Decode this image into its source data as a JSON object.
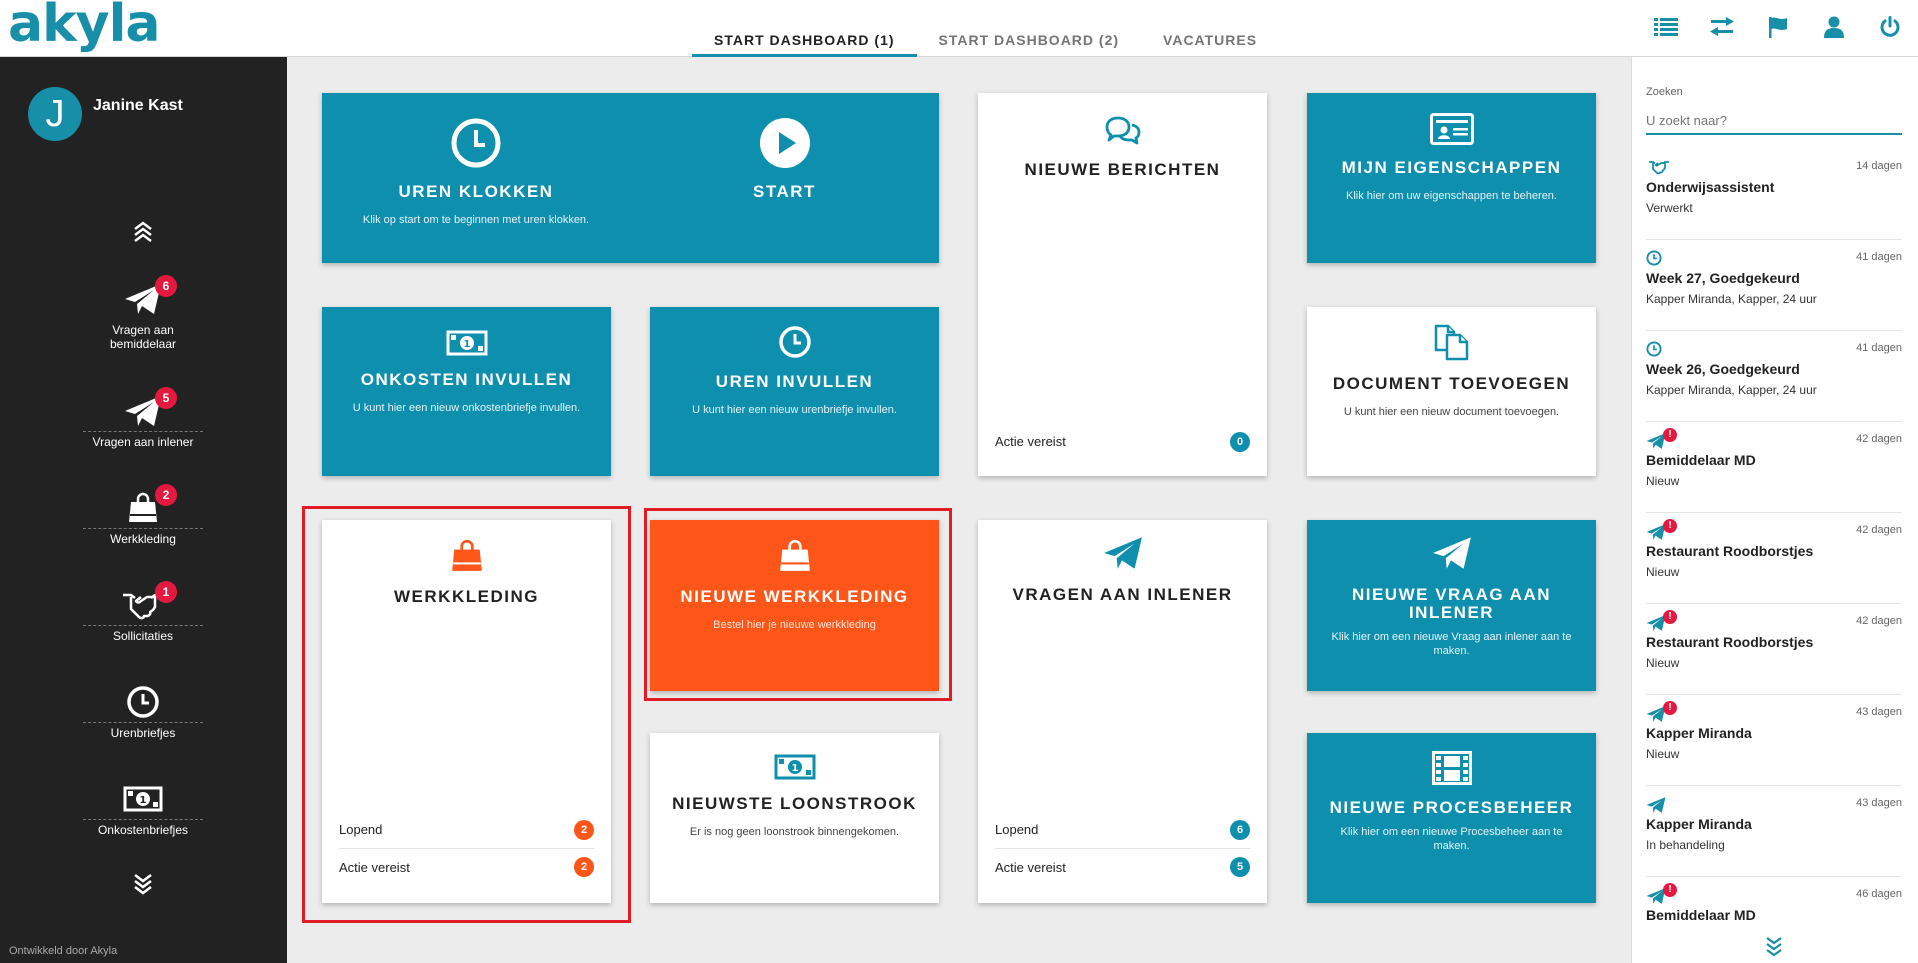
{
  "app": {
    "logo": "akyla",
    "accent": "#178fa8",
    "tile_teal": "#0d8fad",
    "tile_orange": "#fe5519",
    "badge_red": "#e4193f"
  },
  "tabs": [
    {
      "label": "START DASHBOARD (1)",
      "active": true
    },
    {
      "label": "START DASHBOARD (2)",
      "active": false
    },
    {
      "label": "VACATURES",
      "active": false
    }
  ],
  "top_icons": [
    "list-icon",
    "transfer-icon",
    "flag-icon",
    "user-icon",
    "power-icon"
  ],
  "user": {
    "initial": "J",
    "name": "Janine Kast"
  },
  "sidebar": {
    "items": [
      {
        "label": "Vragen aan bemiddelaar",
        "badge": "6",
        "icon": "paper-plane-icon"
      },
      {
        "label": "Vragen aan inlener",
        "badge": "5",
        "icon": "paper-plane-icon"
      },
      {
        "label": "Werkkleding",
        "badge": "2",
        "icon": "shopping-bag-icon"
      },
      {
        "label": "Sollicitaties",
        "badge": "1",
        "icon": "handshake-icon"
      },
      {
        "label": "Urenbriefjes",
        "badge": "",
        "icon": "clock-icon"
      },
      {
        "label": "Onkostenbriefjes",
        "badge": "",
        "icon": "money-icon"
      }
    ],
    "footer": "Ontwikkeld door Akyla"
  },
  "tiles": {
    "uren_klokken": {
      "title": "UREN KLOKKEN",
      "desc": "Klik op start om te beginnen met uren klokken."
    },
    "start": {
      "title": "START"
    },
    "nieuwe_berichten": {
      "title": "NIEUWE BERICHTEN",
      "footer": [
        {
          "label": "Actie vereist",
          "count": "0"
        }
      ]
    },
    "mijn_eigenschappen": {
      "title": "MIJN EIGENSCHAPPEN",
      "desc": "Klik hier om uw eigenschappen te beheren."
    },
    "onkosten_invullen": {
      "title": "ONKOSTEN INVULLEN",
      "desc": "U kunt hier een nieuw onkostenbriefje invullen."
    },
    "uren_invullen": {
      "title": "UREN INVULLEN",
      "desc": "U kunt hier een nieuw urenbriefje invullen."
    },
    "document_toevoegen": {
      "title": "DOCUMENT TOEVOEGEN",
      "desc": "U kunt hier een nieuw document toevoegen."
    },
    "werkkleding": {
      "title": "WERKKLEDING",
      "footer": [
        {
          "label": "Lopend",
          "count": "2"
        },
        {
          "label": "Actie vereist",
          "count": "2"
        }
      ]
    },
    "nieuwe_werkkleding": {
      "title": "NIEUWE WERKKLEDING",
      "desc": "Bestel hier je nieuwe werkkleding"
    },
    "vragen_aan_inlener": {
      "title": "VRAGEN AAN INLENER",
      "footer": [
        {
          "label": "Lopend",
          "count": "6"
        },
        {
          "label": "Actie vereist",
          "count": "5"
        }
      ]
    },
    "nieuwe_vraag_inlener": {
      "title": "NIEUWE VRAAG AAN INLENER",
      "desc": "Klik hier om een nieuwe Vraag aan inlener aan te maken."
    },
    "nieuwste_loonstrook": {
      "title": "NIEUWSTE LOONSTROOK",
      "desc": "Er is nog geen loonstrook binnengekomen."
    },
    "nieuwe_procesbeheer": {
      "title": "NIEUWE PROCESBEHEER",
      "desc": "Klik hier om een nieuwe Procesbeheer aan te maken."
    }
  },
  "search": {
    "label": "Zoeken",
    "placeholder": "U zoekt naar?"
  },
  "feed": [
    {
      "icon": "handshake-icon",
      "date": "14 dagen",
      "title": "Onderwijsassistent",
      "subtitle": "Verwerkt",
      "alert": false
    },
    {
      "icon": "clock-icon",
      "date": "41 dagen",
      "title": "Week 27, Goedgekeurd",
      "subtitle": "Kapper Miranda, Kapper, 24 uur",
      "alert": false
    },
    {
      "icon": "clock-icon",
      "date": "41 dagen",
      "title": "Week 26, Goedgekeurd",
      "subtitle": "Kapper Miranda, Kapper, 24 uur",
      "alert": false
    },
    {
      "icon": "paper-plane-icon",
      "date": "42 dagen",
      "title": "Bemiddelaar MD",
      "subtitle": "Nieuw",
      "alert": true
    },
    {
      "icon": "paper-plane-icon",
      "date": "42 dagen",
      "title": "Restaurant Roodborstjes",
      "subtitle": "Nieuw",
      "alert": true
    },
    {
      "icon": "paper-plane-icon",
      "date": "42 dagen",
      "title": "Restaurant Roodborstjes",
      "subtitle": "Nieuw",
      "alert": true
    },
    {
      "icon": "paper-plane-icon",
      "date": "43 dagen",
      "title": "Kapper Miranda",
      "subtitle": "Nieuw",
      "alert": true
    },
    {
      "icon": "paper-plane-icon",
      "date": "43 dagen",
      "title": "Kapper Miranda",
      "subtitle": "In behandeling",
      "alert": false
    },
    {
      "icon": "paper-plane-icon",
      "date": "46 dagen",
      "title": "Bemiddelaar MD",
      "subtitle": "",
      "alert": true
    }
  ]
}
